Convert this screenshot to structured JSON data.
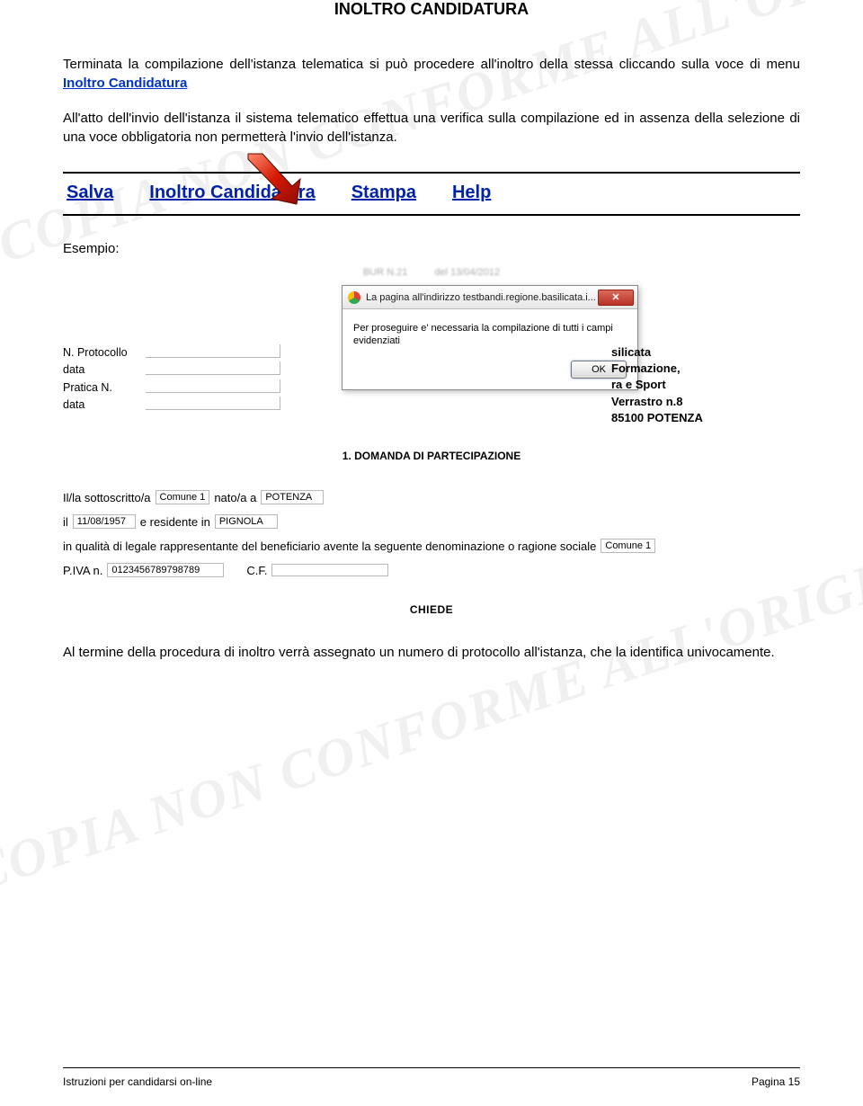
{
  "watermark1": "COPIA NON CONFORME ALL'ORIGINALE",
  "watermark2": "COPIA NON CONFORME ALL'ORIGINALE",
  "title": "INOLTRO CANDIDATURA",
  "para1_pre": "Terminata la compilazione dell'istanza telematica si può procedere all'inoltro della stessa cliccando sulla voce di menu ",
  "para1_link": "Inoltro Candidatura",
  "para2": "All'atto dell'invio dell'istanza il sistema telematico effettua una verifica sulla compilazione ed in assenza della selezione di una voce obbligatoria non permetterà l'invio dell'istanza.",
  "menu": {
    "salva": "Salva",
    "inoltro": "Inoltro Candidatura",
    "stampa": "Stampa",
    "help": "Help"
  },
  "esempio": "Esempio:",
  "bur": {
    "left": "BUR N.21",
    "right": "del 13/04/2012"
  },
  "dialog": {
    "title": "La pagina all'indirizzo testbandi.regione.basilicata.i...",
    "msg": "Per proseguire e' necessaria la compilazione di tutti i campi evidenziati",
    "ok": "OK"
  },
  "proto": {
    "l1": "N. Protocollo",
    "l2": "data",
    "l3": "Pratica N.",
    "l4": "data"
  },
  "addr": {
    "a1": "silicata",
    "a2": "Formazione,",
    "a3": "ra e Sport",
    "a4": "Verrastro n.8",
    "a5": "85100 POTENZA"
  },
  "section1": "1. DOMANDA DI PARTECIPAZIONE",
  "form": {
    "l1a": "Il/la sottoscritto/a",
    "l1v1": "Comune 1",
    "l1b": "nato/a a",
    "l1v2": "POTENZA",
    "l2a": "il",
    "l2v1": "11/08/1957",
    "l2b": "e residente in",
    "l2v2": "PIGNOLA",
    "l3": "in qualità di legale rappresentante del beneficiario avente la seguente denominazione o ragione sociale",
    "l3v": "Comune 1",
    "l4a": "P.IVA n.",
    "l4v1": "0123456789798789",
    "l4b": "C.F.",
    "l4v2": ""
  },
  "chiede": "CHIEDE",
  "para3": "Al termine della procedura di inoltro verrà assegnato un numero di protocollo all'istanza, che la identifica univocamente.",
  "footer": {
    "left": "Istruzioni per candidarsi on-line",
    "right": "Pagina 15"
  }
}
